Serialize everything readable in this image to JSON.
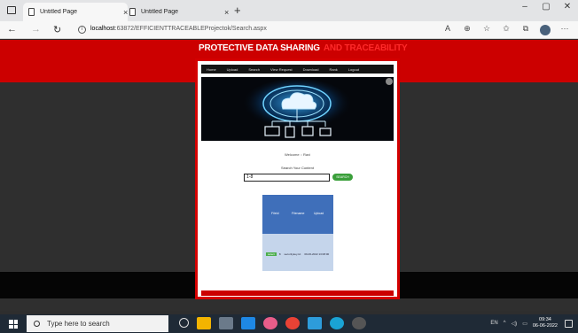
{
  "browser": {
    "tabs": [
      {
        "label": "Untitled Page",
        "close": "×"
      },
      {
        "label": "Untitled Page",
        "close": "×"
      }
    ],
    "new_tab": "+",
    "window_controls": {
      "minimize": "–",
      "maximize": "▢",
      "close": "✕"
    },
    "nav": {
      "back": "←",
      "forward": "→",
      "refresh": "↻"
    },
    "url_host": "localhost",
    "url_path": ":63872/EFFICIENTTRACEABLEProjectok/Search.aspx",
    "tools": [
      "A",
      "⊕",
      "☆",
      "✩",
      "⧉",
      "···"
    ]
  },
  "site": {
    "title_part1": "PROTECTIVE DATA SHARING",
    "title_part2": "AND TRACEABILITY",
    "menu": [
      "Home",
      "Upload",
      "Search",
      "View Request",
      "Download",
      "Rank",
      "Logout"
    ],
    "welcome_text": "Welcome :: Ravi",
    "search_label": "Search Your Content",
    "search_value": "1-8",
    "search_button": "SEARCH DATA",
    "results_headers": [
      "FileId",
      "Filename",
      "Upload"
    ],
    "result_row": {
      "select": "select",
      "id": "8",
      "name": "securitykey.txt",
      "date": "09-06-2022 13:08:00"
    }
  },
  "taskbar": {
    "search_placeholder": "Type here to search",
    "lang": "EN",
    "time": "09:34",
    "date": "06-06-2022"
  },
  "colors": {
    "accent_red": "#cc0000",
    "dark": "#2f2f2f",
    "table_header": "#3f6fba",
    "button_green": "#3a9f3a"
  }
}
